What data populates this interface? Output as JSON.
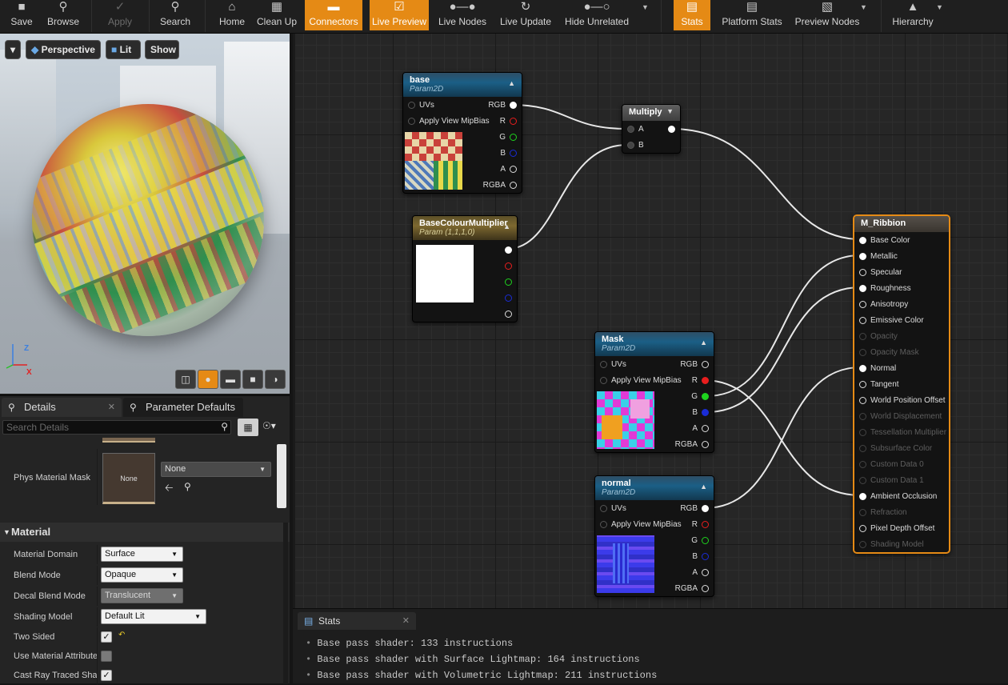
{
  "toolbar": {
    "buttons": [
      {
        "label": "Save",
        "icon": "save-icon",
        "state": "normal"
      },
      {
        "label": "Browse",
        "icon": "browse-icon",
        "state": "normal"
      },
      {
        "label": "Apply",
        "icon": "apply-icon",
        "state": "disabled"
      },
      {
        "label": "Search",
        "icon": "search-icon",
        "state": "normal"
      },
      {
        "label": "Home",
        "icon": "home-icon",
        "state": "normal"
      },
      {
        "label": "Clean Up",
        "icon": "clean-up-icon",
        "state": "normal"
      },
      {
        "label": "Connectors",
        "icon": "connectors-icon",
        "state": "active"
      },
      {
        "label": "Live Preview",
        "icon": "live-preview-icon",
        "state": "active"
      },
      {
        "label": "Live Nodes",
        "icon": "live-nodes-icon",
        "state": "normal"
      },
      {
        "label": "Live Update",
        "icon": "live-update-icon",
        "state": "normal"
      },
      {
        "label": "Hide Unrelated",
        "icon": "hide-unrelated-icon",
        "state": "normal"
      },
      {
        "label": "Stats",
        "icon": "stats-icon",
        "state": "active"
      },
      {
        "label": "Platform Stats",
        "icon": "platform-stats-icon",
        "state": "normal"
      },
      {
        "label": "Preview Nodes",
        "icon": "preview-nodes-icon",
        "state": "normal"
      },
      {
        "label": "Hierarchy",
        "icon": "hierarchy-icon",
        "state": "normal"
      }
    ],
    "colors": {
      "active": "#e58a15"
    }
  },
  "viewport": {
    "view_mode": "Perspective",
    "lit_mode": "Lit",
    "show_label": "Show",
    "axis_labels": {
      "z": "Z",
      "x": "X"
    },
    "shape_buttons": [
      "cylinder-icon",
      "sphere-icon",
      "plane-icon",
      "cube-icon",
      "teapot-icon"
    ]
  },
  "details": {
    "tabs": [
      {
        "label": "Details",
        "icon": "magnifier-icon"
      },
      {
        "label": "Parameter Defaults",
        "icon": "magnifier-icon"
      }
    ],
    "search_placeholder": "Search Details",
    "phys_material_mask": {
      "label": "Phys Material Mask",
      "thumb_text": "None",
      "value": "None"
    },
    "section_title": "Material",
    "properties": [
      {
        "label": "Material Domain",
        "value": "Surface",
        "kind": "combo"
      },
      {
        "label": "Blend Mode",
        "value": "Opaque",
        "kind": "combo"
      },
      {
        "label": "Decal Blend Mode",
        "value": "Translucent",
        "kind": "combo-disabled"
      },
      {
        "label": "Shading Model",
        "value": "Default Lit",
        "kind": "combo"
      },
      {
        "label": "Two Sided",
        "checked": true,
        "kind": "check"
      },
      {
        "label": "Use Material Attributes",
        "checked": false,
        "kind": "check"
      },
      {
        "label": "Cast Ray Traced Shadows",
        "checked": true,
        "kind": "check"
      }
    ]
  },
  "graph": {
    "node_base": {
      "title": "base",
      "subtitle": "Param2D",
      "inputs": [
        "UVs",
        "Apply View MipBias"
      ],
      "outputs": [
        "RGB",
        "R",
        "G",
        "B",
        "A",
        "RGBA"
      ]
    },
    "node_multiplier": {
      "title": "BaseColourMultiplier",
      "subtitle": "Param (1,1,1,0)"
    },
    "node_multiply": {
      "title": "Multiply",
      "inputs": [
        "A",
        "B"
      ]
    },
    "node_mask": {
      "title": "Mask",
      "subtitle": "Param2D",
      "inputs": [
        "UVs",
        "Apply View MipBias"
      ],
      "outputs": [
        "RGB",
        "R",
        "G",
        "B",
        "A",
        "RGBA"
      ]
    },
    "node_normal": {
      "title": "normal",
      "subtitle": "Param2D",
      "inputs": [
        "UVs",
        "Apply View MipBias"
      ],
      "outputs": [
        "RGB",
        "R",
        "G",
        "B",
        "A",
        "RGBA"
      ]
    },
    "material_node": {
      "title": "M_Ribbion",
      "inputs": [
        {
          "label": "Base Color",
          "enabled": true,
          "connected": true
        },
        {
          "label": "Metallic",
          "enabled": true,
          "connected": true
        },
        {
          "label": "Specular",
          "enabled": true,
          "connected": false
        },
        {
          "label": "Roughness",
          "enabled": true,
          "connected": true
        },
        {
          "label": "Anisotropy",
          "enabled": true,
          "connected": false
        },
        {
          "label": "Emissive Color",
          "enabled": true,
          "connected": false
        },
        {
          "label": "Opacity",
          "enabled": false,
          "connected": false
        },
        {
          "label": "Opacity Mask",
          "enabled": false,
          "connected": false
        },
        {
          "label": "Normal",
          "enabled": true,
          "connected": true
        },
        {
          "label": "Tangent",
          "enabled": true,
          "connected": false
        },
        {
          "label": "World Position Offset",
          "enabled": true,
          "connected": false
        },
        {
          "label": "World Displacement",
          "enabled": false,
          "connected": false
        },
        {
          "label": "Tessellation Multiplier",
          "enabled": false,
          "connected": false
        },
        {
          "label": "Subsurface Color",
          "enabled": false,
          "connected": false
        },
        {
          "label": "Custom Data 0",
          "enabled": false,
          "connected": false
        },
        {
          "label": "Custom Data 1",
          "enabled": false,
          "connected": false
        },
        {
          "label": "Ambient Occlusion",
          "enabled": true,
          "connected": true
        },
        {
          "label": "Refraction",
          "enabled": false,
          "connected": false
        },
        {
          "label": "Pixel Depth Offset",
          "enabled": true,
          "connected": false
        },
        {
          "label": "Shading Model",
          "enabled": false,
          "connected": false
        }
      ],
      "colors": {
        "border": "#e58a15"
      }
    }
  },
  "stats": {
    "tab_label": "Stats",
    "lines": [
      "Base pass shader: 133 instructions",
      "Base pass shader with Surface Lightmap: 164 instructions",
      "Base pass shader with Volumetric Lightmap: 211 instructions"
    ]
  }
}
